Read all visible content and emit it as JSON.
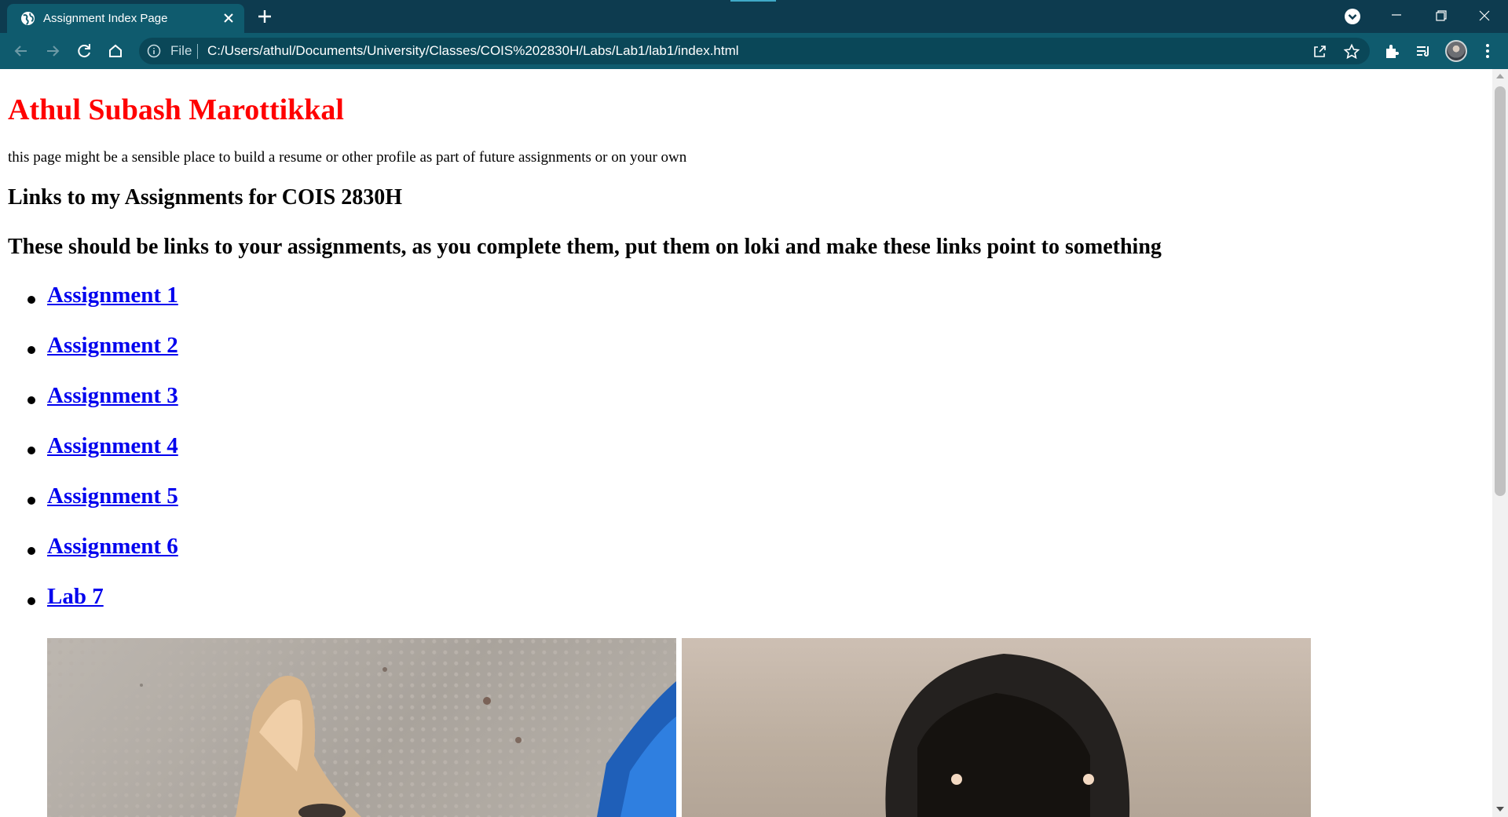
{
  "browser": {
    "tab": {
      "title": "Assignment Index Page",
      "favicon": "globe-icon"
    },
    "toolbar": {
      "scheme_label": "File",
      "url": "C:/Users/athul/Documents/University/Classes/COIS%202830H/Labs/Lab1/lab1/index.html"
    },
    "icons": [
      "back-icon",
      "forward-icon",
      "reload-icon",
      "home-icon",
      "info-icon",
      "share-icon",
      "star-icon",
      "extensions-icon",
      "reading-list-icon",
      "avatar",
      "menu-icon"
    ],
    "colors": {
      "frame": "#0d3b4f",
      "toolbar": "#0f5b6e",
      "omnibox": "#0a4758"
    }
  },
  "page": {
    "title": "Athul Subash Marottikkal",
    "intro": "this page might be a sensible place to build a resume or other profile as part of future assignments or on your own",
    "heading_links": "Links to my Assignments for COIS 2830H",
    "heading_note": "These should be links to your assignments, as you complete them, put them on loki and make these links point to something",
    "links": [
      {
        "label": "Assignment 1"
      },
      {
        "label": "Assignment 2"
      },
      {
        "label": "Assignment 3"
      },
      {
        "label": "Assignment 4"
      },
      {
        "label": "Assignment 5"
      },
      {
        "label": "Assignment 6"
      },
      {
        "label": "Lab 7"
      }
    ],
    "colors": {
      "title": "#ff0000",
      "link": "#0000ee"
    }
  }
}
